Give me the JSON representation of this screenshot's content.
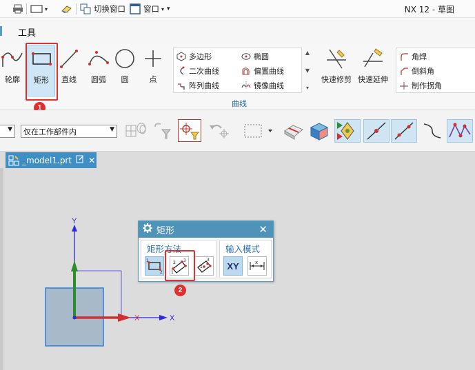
{
  "titlebar": {
    "switch_window_label": "切换窗口",
    "window_menu_label": "窗口",
    "app_title": "NX 12 - 草图"
  },
  "menu": {
    "tools_tab": "工具"
  },
  "ribbon": {
    "buttons": [
      {
        "label": "轮廓",
        "icon": "profile-icon"
      },
      {
        "label": "矩形",
        "icon": "rectangle-icon"
      },
      {
        "label": "直线",
        "icon": "line-icon"
      },
      {
        "label": "圆弧",
        "icon": "arc-icon"
      },
      {
        "label": "圆",
        "icon": "circle-icon"
      },
      {
        "label": "点",
        "icon": "point-icon"
      }
    ],
    "curve_items": [
      {
        "label": "多边形",
        "icon": "polygon-icon"
      },
      {
        "label": "椭圆",
        "icon": "ellipse-icon"
      },
      {
        "label": "二次曲线",
        "icon": "conic-icon"
      },
      {
        "label": "偏置曲线",
        "icon": "offset-curve-icon"
      },
      {
        "label": "阵列曲线",
        "icon": "pattern-curve-icon"
      },
      {
        "label": "镜像曲线",
        "icon": "mirror-curve-icon"
      }
    ],
    "quick_trim": "快速修剪",
    "quick_extend": "快速延伸",
    "group_label": "曲线",
    "right_items": [
      {
        "label": "角焊",
        "icon": "fillet-icon"
      },
      {
        "label": "倒斜角",
        "icon": "chamfer-icon"
      },
      {
        "label": "制作拐角",
        "icon": "make-corner-icon"
      }
    ]
  },
  "annotations": {
    "step1": "1",
    "step2": "2"
  },
  "filterbar": {
    "scope_select": "仅在工作部件内"
  },
  "document": {
    "tab_name": "_model1.prt"
  },
  "canvas": {
    "y_axis_label": "Y",
    "x_axis_label_red": "X",
    "x_axis_label_blue": "X"
  },
  "dialog": {
    "title": "矩形",
    "method_section": "矩形方法",
    "input_section": "输入模式",
    "xy_label": "XY"
  },
  "colors": {
    "accent_blue": "#4f94b8",
    "highlight_red": "#e0302e",
    "group_label_blue": "#2a6fae"
  }
}
